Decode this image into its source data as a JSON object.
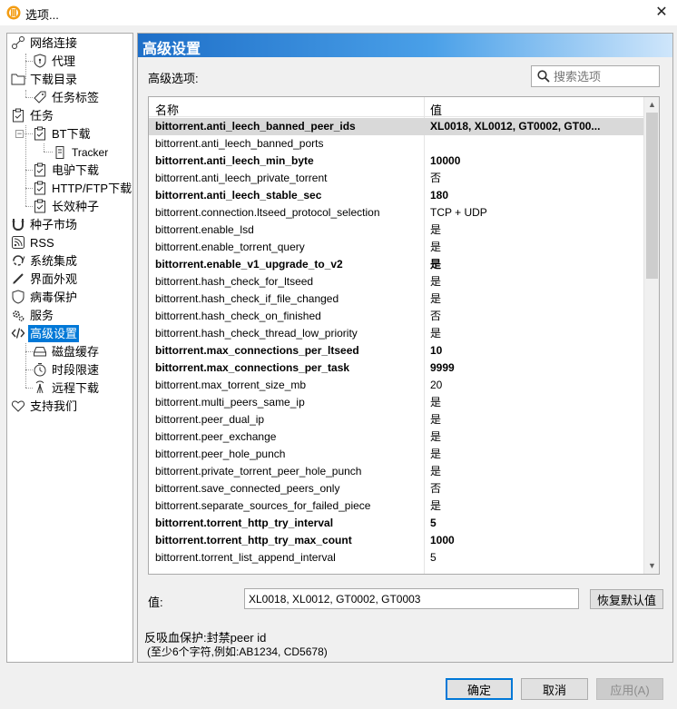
{
  "window": {
    "title": "选项...",
    "close_glyph": "✕"
  },
  "tree": {
    "items": [
      {
        "label": "网络连接",
        "icon": "network-icon"
      },
      {
        "label": "代理",
        "icon": "shield-icon"
      },
      {
        "label": "下载目录",
        "icon": "folder-icon"
      },
      {
        "label": "任务标签",
        "icon": "tag-icon"
      },
      {
        "label": "任务",
        "icon": "clipboard-icon"
      },
      {
        "label": "BT下载",
        "icon": "clipboard-icon"
      },
      {
        "label": "Tracker",
        "icon": "tracker-icon"
      },
      {
        "label": "电驴下载",
        "icon": "clipboard-icon"
      },
      {
        "label": "HTTP/FTP下载",
        "icon": "clipboard-icon"
      },
      {
        "label": "长效种子",
        "icon": "clipboard-icon"
      },
      {
        "label": "种子市场",
        "icon": "magnet-icon"
      },
      {
        "label": "RSS",
        "icon": "rss-icon"
      },
      {
        "label": "系统集成",
        "icon": "integration-icon"
      },
      {
        "label": "界面外观",
        "icon": "brush-icon"
      },
      {
        "label": "病毒保护",
        "icon": "shield-icon"
      },
      {
        "label": "服务",
        "icon": "gears-icon"
      },
      {
        "label": "高级设置",
        "icon": "code-icon"
      },
      {
        "label": "磁盘缓存",
        "icon": "disk-icon"
      },
      {
        "label": "时段限速",
        "icon": "clock-icon"
      },
      {
        "label": "远程下载",
        "icon": "remote-icon"
      },
      {
        "label": "支持我们",
        "icon": "heart-icon"
      }
    ]
  },
  "panel": {
    "header": "高级设置",
    "options_label": "高级选项:",
    "search_placeholder": "搜索选项",
    "columns": {
      "name": "名称",
      "value": "值"
    },
    "rows": [
      {
        "key": "bittorrent.anti_leech_banned_peer_ids",
        "value": "XL0018, XL0012, GT0002, GT00...",
        "bold": true,
        "selected": true
      },
      {
        "key": "bittorrent.anti_leech_banned_ports",
        "value": "",
        "bold": false
      },
      {
        "key": "bittorrent.anti_leech_min_byte",
        "value": "10000",
        "bold": true
      },
      {
        "key": "bittorrent.anti_leech_private_torrent",
        "value": "否",
        "bold": false
      },
      {
        "key": "bittorrent.anti_leech_stable_sec",
        "value": "180",
        "bold": true
      },
      {
        "key": "bittorrent.connection.ltseed_protocol_selection",
        "value": "TCP + UDP",
        "bold": false
      },
      {
        "key": "bittorrent.enable_lsd",
        "value": "是",
        "bold": false
      },
      {
        "key": "bittorrent.enable_torrent_query",
        "value": "是",
        "bold": false
      },
      {
        "key": "bittorrent.enable_v1_upgrade_to_v2",
        "value": "是",
        "bold": true
      },
      {
        "key": "bittorrent.hash_check_for_ltseed",
        "value": "是",
        "bold": false
      },
      {
        "key": "bittorrent.hash_check_if_file_changed",
        "value": "是",
        "bold": false
      },
      {
        "key": "bittorrent.hash_check_on_finished",
        "value": "否",
        "bold": false
      },
      {
        "key": "bittorrent.hash_check_thread_low_priority",
        "value": "是",
        "bold": false
      },
      {
        "key": "bittorrent.max_connections_per_ltseed",
        "value": "10",
        "bold": true
      },
      {
        "key": "bittorrent.max_connections_per_task",
        "value": "9999",
        "bold": true
      },
      {
        "key": "bittorrent.max_torrent_size_mb",
        "value": "20",
        "bold": false
      },
      {
        "key": "bittorrent.multi_peers_same_ip",
        "value": "是",
        "bold": false
      },
      {
        "key": "bittorrent.peer_dual_ip",
        "value": "是",
        "bold": false
      },
      {
        "key": "bittorrent.peer_exchange",
        "value": "是",
        "bold": false
      },
      {
        "key": "bittorrent.peer_hole_punch",
        "value": "是",
        "bold": false
      },
      {
        "key": "bittorrent.private_torrent_peer_hole_punch",
        "value": "是",
        "bold": false
      },
      {
        "key": "bittorrent.save_connected_peers_only",
        "value": "否",
        "bold": false
      },
      {
        "key": "bittorrent.separate_sources_for_failed_piece",
        "value": "是",
        "bold": false
      },
      {
        "key": "bittorrent.torrent_http_try_interval",
        "value": "5",
        "bold": true
      },
      {
        "key": "bittorrent.torrent_http_try_max_count",
        "value": "1000",
        "bold": true
      },
      {
        "key": "bittorrent.torrent_list_append_interval",
        "value": "5",
        "bold": false
      }
    ],
    "value_label": "值:",
    "value_text": "XL0018, XL0012, GT0002, GT0003",
    "restore_button": "恢复默认值",
    "description_title": "反吸血保护:封禁peer id",
    "description_hint": "(至少6个字符,例如:AB1234, CD5678)"
  },
  "buttons": {
    "ok": "确定",
    "cancel": "取消",
    "apply": "应用(A)"
  },
  "colors": {
    "accent": "#0078d7",
    "header_start": "#1e6fc8",
    "selected_row": "#d9d9d9"
  }
}
